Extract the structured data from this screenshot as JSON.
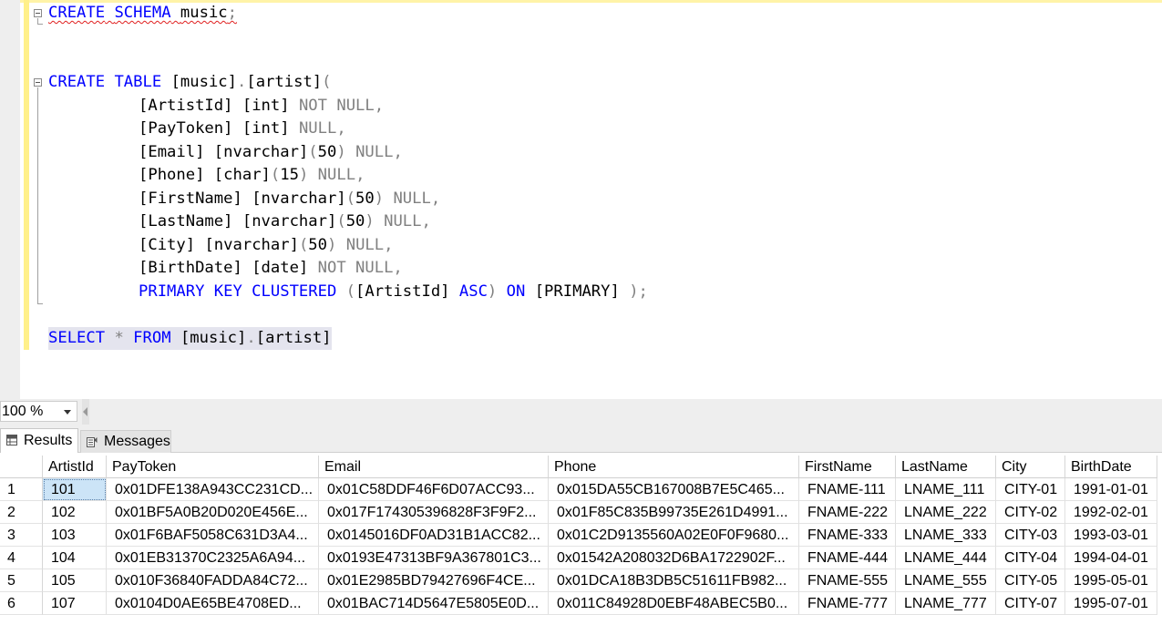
{
  "editor": {
    "lines": {
      "l1": {
        "kw1": "CREATE",
        "kw2": "SCHEMA",
        "name": "music",
        "semi": ";"
      },
      "l2": {
        "kw1": "CREATE",
        "kw2": "TABLE",
        "obj": "[music]",
        "dot": ".",
        "tbl": "[artist]",
        "paren": "("
      },
      "c1": {
        "col": "[ArtistId]",
        "type": "[int]",
        "mod": "NOT NULL,"
      },
      "c2": {
        "col": "[PayToken]",
        "type": "[int]",
        "mod": "NULL,"
      },
      "c3": {
        "col": "[Email]",
        "type": "[nvarchar]",
        "p1": "(",
        "num": "50",
        "p2": ")",
        "mod": "NULL,"
      },
      "c4": {
        "col": "[Phone]",
        "type": "[char]",
        "p1": "(",
        "num": "15",
        "p2": ")",
        "mod": "NULL,"
      },
      "c5": {
        "col": "[FirstName]",
        "type": "[nvarchar]",
        "p1": "(",
        "num": "50",
        "p2": ")",
        "mod": "NULL,"
      },
      "c6": {
        "col": "[LastName]",
        "type": "[nvarchar]",
        "p1": "(",
        "num": "50",
        "p2": ")",
        "mod": "NULL,"
      },
      "c7": {
        "col": "[City]",
        "type": "[nvarchar]",
        "p1": "(",
        "num": "50",
        "p2": ")",
        "mod": "NULL,"
      },
      "c8": {
        "col": "[BirthDate]",
        "type": "[date]",
        "mod": "NOT NULL,"
      },
      "pk": {
        "kw": "PRIMARY KEY CLUSTERED",
        "p1": "(",
        "col": "[ArtistId]",
        "asc": "ASC",
        "p2": ")",
        "on": "ON",
        "fg": "[PRIMARY]",
        "end": ");"
      },
      "sel": {
        "kw1": "SELECT",
        "star": "*",
        "kw2": "FROM",
        "obj": "[music]",
        "dot": ".",
        "tbl": "[artist]"
      }
    }
  },
  "zoom": {
    "value": "100 %"
  },
  "tabs": {
    "results": "Results",
    "messages": "Messages"
  },
  "grid": {
    "columns": [
      "ArtistId",
      "PayToken",
      "Email",
      "Phone",
      "FirstName",
      "LastName",
      "City",
      "BirthDate"
    ],
    "rows": [
      {
        "num": "1",
        "cells": [
          "101",
          "0x01DFE138A943CC231CD...",
          "0x01C58DDF46F6D07ACC93...",
          "0x015DA55CB167008B7E5C465...",
          "FNAME-111",
          "LNAME_111",
          "CITY-01",
          "1991-01-01"
        ]
      },
      {
        "num": "2",
        "cells": [
          "102",
          "0x01BF5A0B20D020E456E...",
          "0x017F174305396828F3F9F2...",
          "0x01F85C835B99735E261D4991...",
          "FNAME-222",
          "LNAME_222",
          "CITY-02",
          "1992-02-01"
        ]
      },
      {
        "num": "3",
        "cells": [
          "103",
          "0x01F6BAF5058C631D3A4...",
          "0x0145016DF0AD31B1ACC82...",
          "0x01C2D9135560A02E0F0F9680...",
          "FNAME-333",
          "LNAME_333",
          "CITY-03",
          "1993-03-01"
        ]
      },
      {
        "num": "4",
        "cells": [
          "104",
          "0x01EB31370C2325A6A94...",
          "0x0193E47313BF9A367801C3...",
          "0x01542A208032D6BA1722902F...",
          "FNAME-444",
          "LNAME_444",
          "CITY-04",
          "1994-04-01"
        ]
      },
      {
        "num": "5",
        "cells": [
          "105",
          "0x010F36840FADDA84C72...",
          "0x01E2985BD79427696F4CE...",
          "0x01DCA18B3DB5C51611FB982...",
          "FNAME-555",
          "LNAME_555",
          "CITY-05",
          "1995-05-01"
        ]
      },
      {
        "num": "6",
        "cells": [
          "107",
          "0x0104D0AE65BE4708ED...",
          "0x01BAC714D5647E5805E0D...",
          "0x011C84928D0EBF48ABEC5B0...",
          "FNAME-777",
          "LNAME_777",
          "CITY-07",
          "1995-07-01"
        ]
      }
    ]
  }
}
